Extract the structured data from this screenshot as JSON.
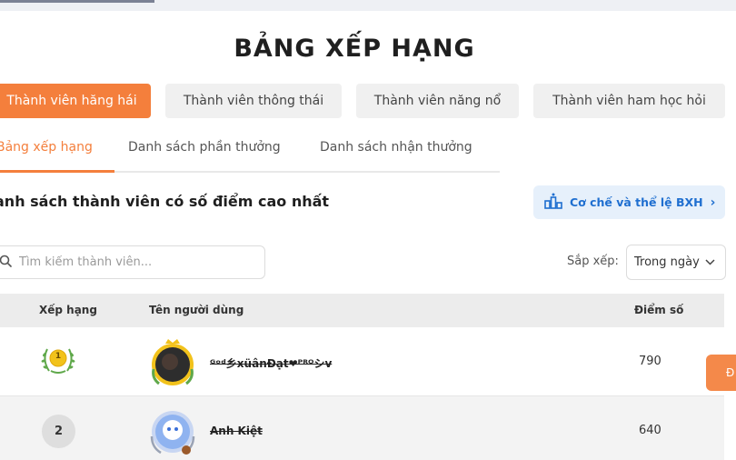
{
  "page": {
    "title": "BẢNG XẾP HẠNG"
  },
  "categories": [
    {
      "label": "Thành viên hăng hái",
      "active": true
    },
    {
      "label": "Thành viên thông thái",
      "active": false
    },
    {
      "label": "Thành viên năng nổ",
      "active": false
    },
    {
      "label": "Thành viên ham học hỏi",
      "active": false
    }
  ],
  "tabs": [
    {
      "label": "Bảng xếp hạng",
      "active": true
    },
    {
      "label": "Danh sách phần thưởng",
      "active": false
    },
    {
      "label": "Danh sách nhận thưởng",
      "active": false
    }
  ],
  "section": {
    "title": "anh sách thành viên có số điểm cao nhất",
    "rules_button": "Cơ chế và thể lệ BXH"
  },
  "search": {
    "placeholder": "Tìm kiếm thành viên...",
    "value": ""
  },
  "sort": {
    "label": "Sắp xếp:",
    "selected": "Trong ngày"
  },
  "table": {
    "headers": {
      "rank": "Xếp hạng",
      "user": "Tên người dùng",
      "score": "Điểm số"
    },
    "rows": [
      {
        "rank": "1",
        "name": "ᴳᵒᵈ乡xüânĐạt❤ᴾᴿᴼシv",
        "score": "790"
      },
      {
        "rank": "2",
        "name": "Anh Kiệt",
        "score": "640"
      }
    ]
  },
  "floating_button": {
    "label": "Đ"
  },
  "colors": {
    "accent": "#f47f3c",
    "rules_bg": "#e6f0fb",
    "rules_text": "#1f6fd0",
    "gold": "#f2c21b"
  },
  "icons": {
    "search": "search-icon",
    "rules": "podium-icon",
    "sort": "chevron-down-icon",
    "rank1": "laurel-medal-icon"
  }
}
